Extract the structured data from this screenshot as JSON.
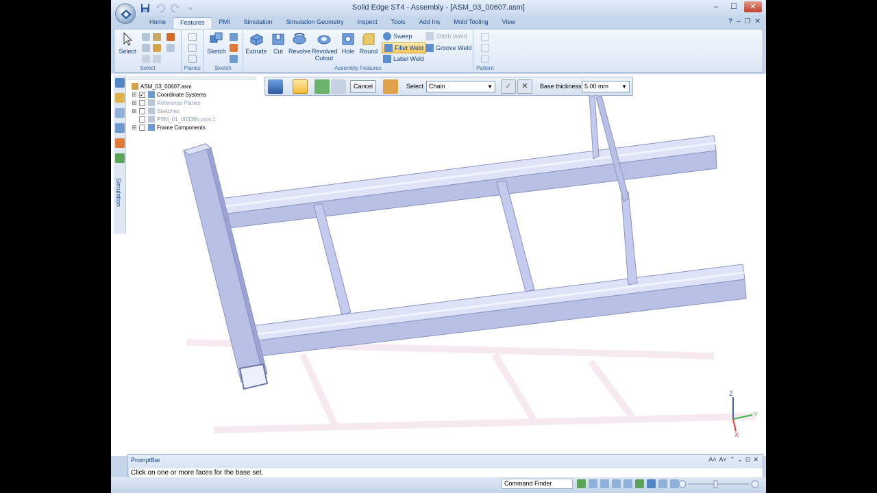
{
  "window": {
    "title": "Solid Edge ST4 - Assembly - [ASM_03_00607.asm]",
    "minimize": "–",
    "maximize": "☐",
    "close": "✕"
  },
  "tabs": [
    "Home",
    "Features",
    "PMI",
    "Simulation",
    "Simulation Geometry",
    "Inspect",
    "Tools",
    "Add Ins",
    "Mold Tooling",
    "View"
  ],
  "active_tab": "Features",
  "tab_right": {
    "help": "?",
    "min": "–",
    "restore": "❐",
    "close": "✕"
  },
  "ribbon": {
    "select": {
      "button": "Select",
      "group": "Select"
    },
    "planes": {
      "group": "Planes"
    },
    "sketch": {
      "button": "Sketch",
      "group": "Sketch"
    },
    "assembly_features": {
      "group": "Assembly Features",
      "extrude": "Extrude",
      "cut": "Cut",
      "revolve": "Revolve",
      "revolved_cutout_1": "Revolved",
      "revolved_cutout_2": "Cutout",
      "hole": "Hole",
      "round": "Round",
      "sweep": "Sweep",
      "fillet_weld": "Fillet Weld",
      "label_weld": "Label Weld",
      "stitch_weld": "Stitch Weld",
      "groove_weld": "Groove Weld"
    },
    "pattern": {
      "group": "Pattern"
    }
  },
  "tree": {
    "root": "ASM_03_00607.asm",
    "items": [
      {
        "label": "Coordinate Systems",
        "expander": "⊞",
        "checked": "✓",
        "faded": false
      },
      {
        "label": "Reference Planes",
        "expander": "⊞",
        "checked": "",
        "faded": true
      },
      {
        "label": "Sketches",
        "expander": "⊞",
        "checked": "",
        "faded": true
      },
      {
        "label": "PSM_01_00338b.psm:1",
        "expander": "",
        "checked": "",
        "faded": true
      },
      {
        "label": "Frame Components",
        "expander": "⊞",
        "checked": "",
        "faded": false
      }
    ]
  },
  "left_panel": {
    "vertical_label": "Simulation"
  },
  "commandbar": {
    "cancel": "Cancel",
    "select_label": "Select",
    "select_value": "Chain",
    "base_thickness_label": "Base thickness:",
    "base_thickness_value": "5.00 mm"
  },
  "triad": {
    "z": "Z",
    "y": "Y",
    "x": "X"
  },
  "promptbar": {
    "title": "PromptBar",
    "text": "Click on one or more faces for the base set.",
    "controls": [
      "A˄",
      "A˅",
      "⌃",
      "⌄",
      "⊡",
      "✕"
    ]
  },
  "statusbar": {
    "command_finder": "Command Finder"
  },
  "colors": {
    "frame_face": "#b8c0e6",
    "frame_top": "#dfe3f7",
    "frame_edge": "#8a92bf",
    "ghost": "#f6e8ef",
    "ribbon_bg": "#dce7f5"
  }
}
